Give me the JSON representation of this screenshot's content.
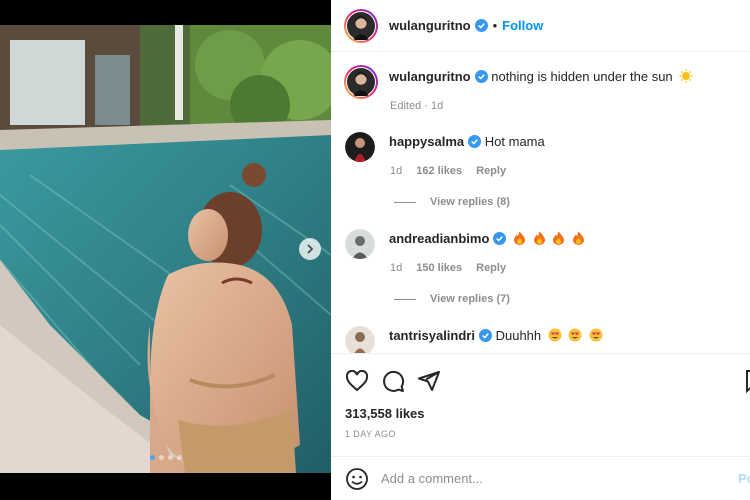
{
  "post": {
    "author": "wulanguritno",
    "follow_label": "Follow",
    "separator": "•",
    "caption_text": "nothing is hidden under the sun",
    "caption_meta": "Edited · 1d"
  },
  "comments": [
    {
      "user": "happysalma",
      "text": "Hot mama",
      "time": "1d",
      "likes": "162 likes",
      "reply": "Reply",
      "view_replies": "View replies (8)"
    },
    {
      "user": "andreadianbimo",
      "text": "",
      "time": "1d",
      "likes": "150 likes",
      "reply": "Reply",
      "view_replies": "View replies (7)"
    },
    {
      "user": "tantrisyalindri",
      "text": "Duuhhh",
      "time": "",
      "likes": "",
      "reply": "",
      "view_replies": ""
    }
  ],
  "stats": {
    "likes": "313,558 likes",
    "age": "1 DAY AGO"
  },
  "composer": {
    "placeholder": "Add a comment...",
    "post_label": "Post"
  },
  "carousel": {
    "total": 4,
    "active_index": 0
  },
  "icons": {
    "like": "heart-icon",
    "comment": "comment-icon",
    "share": "share-icon",
    "save": "bookmark-icon",
    "emoji": "smiley-icon",
    "verified": "verified-badge-icon",
    "next": "chevron-right-icon"
  },
  "colors": {
    "accent": "#0095f6",
    "verified": "#3897f0",
    "text": "#262626",
    "muted": "#8e8e8e"
  }
}
